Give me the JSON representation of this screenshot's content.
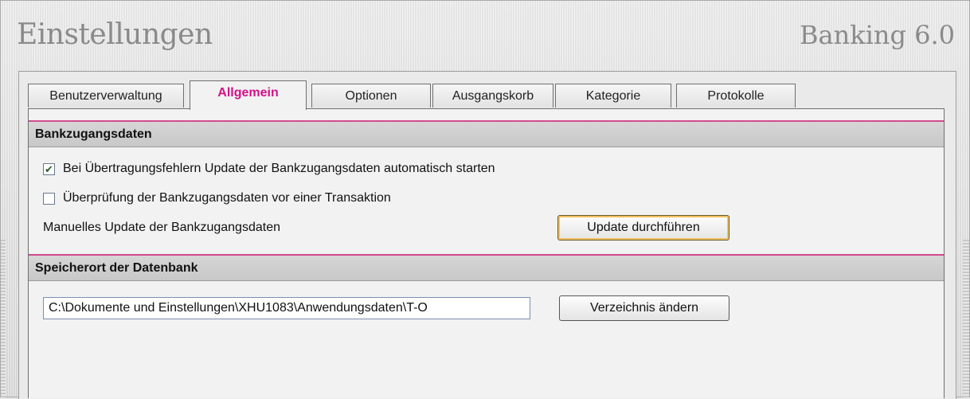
{
  "window": {
    "title": "Einstellungen",
    "brand": "Banking 6.0"
  },
  "tabs": [
    {
      "label": "Benutzerverwaltung",
      "active": false
    },
    {
      "label": "Allgemein",
      "active": true
    },
    {
      "label": "Optionen",
      "active": false
    },
    {
      "label": "Ausgangskorb",
      "active": false
    },
    {
      "label": "Kategorie",
      "active": false
    },
    {
      "label": "Protokolle",
      "active": false
    }
  ],
  "bankzugang": {
    "heading": "Bankzugangsdaten",
    "auto_update": {
      "label": "Bei Übertragungsfehlern Update der Bankzugangsdaten automatisch starten",
      "checked": true
    },
    "verify": {
      "label": "Überprüfung der Bankzugangsdaten vor einer Transaktion",
      "checked": false
    },
    "manual_label": "Manuelles Update der Bankzugangsdaten",
    "update_button": "Update durchführen"
  },
  "speicherort": {
    "heading": "Speicherort der Datenbank",
    "path_value": "C:\\Dokumente und Einstellungen\\XHU1083\\Anwendungsdaten\\T-O",
    "change_button": "Verzeichnis ändern"
  },
  "colors": {
    "accent": "#d4118a",
    "section_rule": "#d04a8c"
  }
}
